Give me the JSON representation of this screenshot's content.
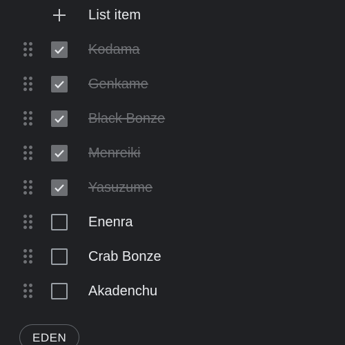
{
  "add_item": {
    "label": "List item",
    "icon": "plus-icon"
  },
  "items": [
    {
      "label": "Kodama",
      "checked": true
    },
    {
      "label": "Genkame",
      "checked": true
    },
    {
      "label": "Black Bonze",
      "checked": true
    },
    {
      "label": "Menreiki",
      "checked": true
    },
    {
      "label": "Yasuzume",
      "checked": true
    },
    {
      "label": "Enenra",
      "checked": false
    },
    {
      "label": "Crab Bonze",
      "checked": false
    },
    {
      "label": "Akadenchu",
      "checked": false
    }
  ],
  "label_chip": {
    "text": "EDEN"
  },
  "colors": {
    "background": "#202124",
    "text": "#e8eaed",
    "muted": "#6f7175"
  }
}
